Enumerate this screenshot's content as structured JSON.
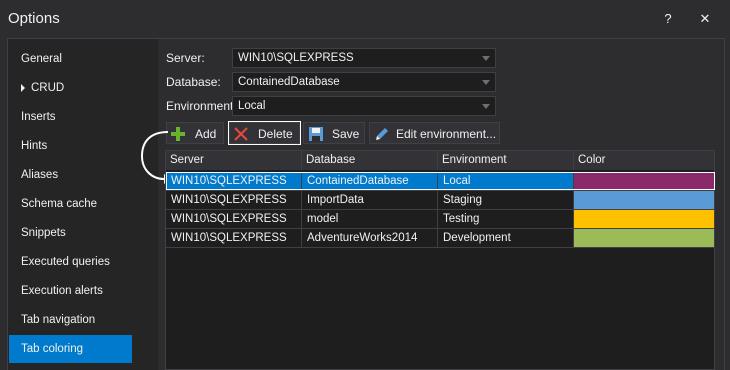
{
  "window": {
    "title": "Options",
    "help_glyph": "?",
    "close_glyph": "✕"
  },
  "sidebar": {
    "items": [
      {
        "label": "General"
      },
      {
        "label": "CRUD"
      },
      {
        "label": "Inserts"
      },
      {
        "label": "Hints"
      },
      {
        "label": "Aliases"
      },
      {
        "label": "Schema cache"
      },
      {
        "label": "Snippets"
      },
      {
        "label": "Executed queries"
      },
      {
        "label": "Execution alerts"
      },
      {
        "label": "Tab navigation"
      },
      {
        "label": "Tab coloring"
      }
    ]
  },
  "form": {
    "server": {
      "label": "Server:",
      "value": "WIN10\\SQLEXPRESS"
    },
    "database": {
      "label": "Database:",
      "value": "ContainedDatabase"
    },
    "environment": {
      "label": "Environment:",
      "value": "Local"
    }
  },
  "toolbar": {
    "add_label": "Add",
    "delete_label": "Delete",
    "save_label": "Save",
    "edit_label": "Edit environment..."
  },
  "grid": {
    "columns": [
      "Server",
      "Database",
      "Environment",
      "Color"
    ],
    "rows": [
      {
        "server": "WIN10\\SQLEXPRESS",
        "database": "ContainedDatabase",
        "environment": "Local",
        "color": "#8b2a6a"
      },
      {
        "server": "WIN10\\SQLEXPRESS",
        "database": "ImportData",
        "environment": "Staging",
        "color": "#5b9bd5"
      },
      {
        "server": "WIN10\\SQLEXPRESS",
        "database": "model",
        "environment": "Testing",
        "color": "#ffc000"
      },
      {
        "server": "WIN10\\SQLEXPRESS",
        "database": "AdventureWorks2014",
        "environment": "Development",
        "color": "#9bbb59"
      }
    ]
  },
  "colors": {
    "accent": "#007acc"
  }
}
